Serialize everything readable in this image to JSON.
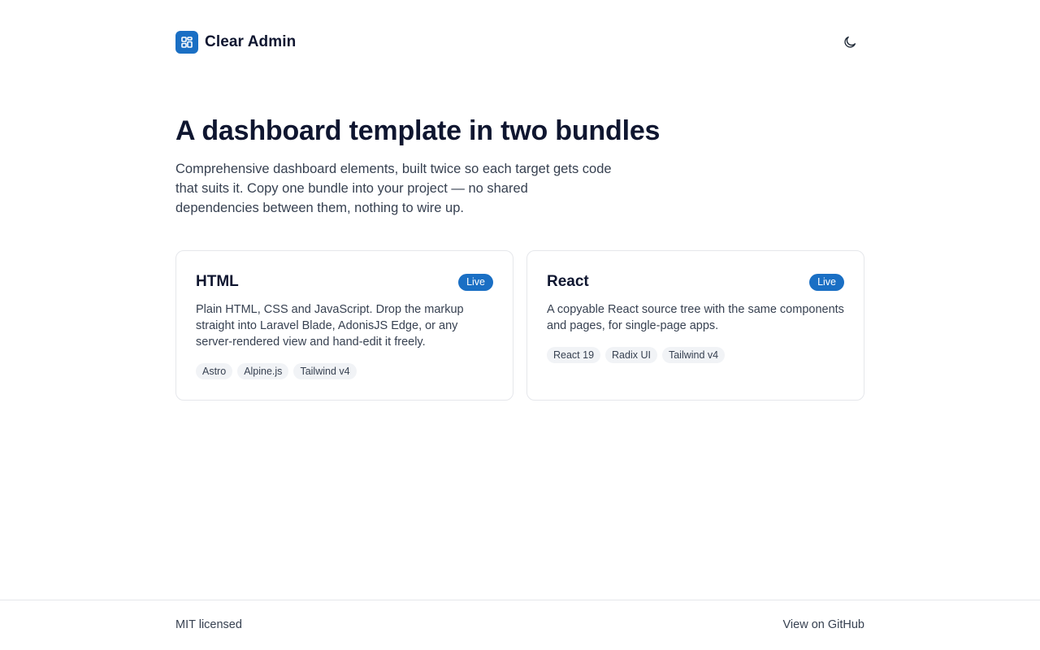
{
  "header": {
    "brand": "Clear Admin",
    "logo_icon": "dashboard-grid-icon",
    "theme_toggle_icon": "moon-icon",
    "accent": "#1a6fc4"
  },
  "hero": {
    "title": "A dashboard template in two bundles",
    "description": "Comprehensive dashboard elements, built twice so each target gets code that suits it. Copy one bundle into your project — no shared dependencies between them, nothing to wire up."
  },
  "cards": [
    {
      "title": "HTML",
      "badge": "Live",
      "description": "Plain HTML, CSS and JavaScript. Drop the markup straight into Laravel Blade, AdonisJS Edge, or any server-rendered view and hand-edit it freely.",
      "tags": [
        "Astro",
        "Alpine.js",
        "Tailwind v4"
      ]
    },
    {
      "title": "React",
      "badge": "Live",
      "description": "A copyable React source tree with the same components and pages, for single-page apps.",
      "tags": [
        "React 19",
        "Radix UI",
        "Tailwind v4"
      ]
    }
  ],
  "footer": {
    "license": "MIT licensed",
    "github_link": "View on GitHub"
  }
}
